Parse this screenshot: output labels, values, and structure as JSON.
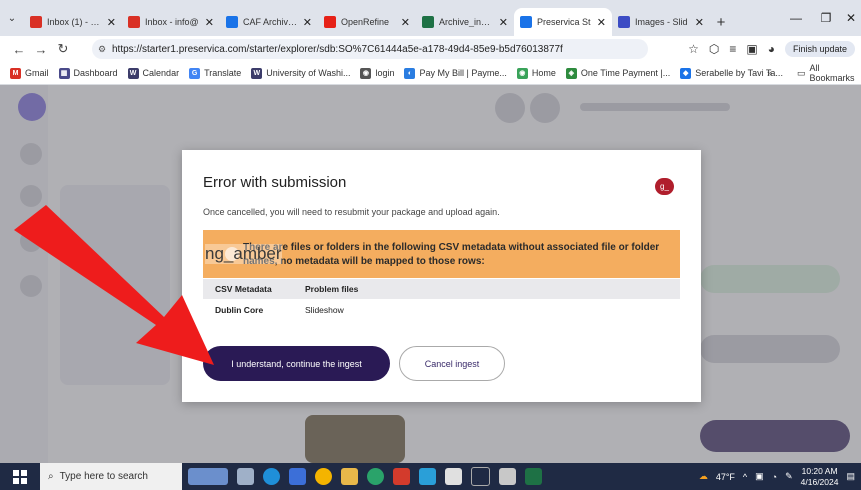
{
  "browser": {
    "tabs": [
      {
        "title": "Inbox (1) - tay",
        "icon": "gmail-icon",
        "color": "#d93025",
        "active": false
      },
      {
        "title": "Inbox - info@",
        "icon": "gmail-icon",
        "color": "#d93025",
        "active": false
      },
      {
        "title": "CAF Archive P",
        "icon": "doc-icon",
        "color": "#1a73e8",
        "active": false
      },
      {
        "title": "OpenRefine",
        "icon": "youtube-icon",
        "color": "#e62117",
        "active": false
      },
      {
        "title": "Archive_inven",
        "icon": "excel-icon",
        "color": "#1e7145",
        "active": false
      },
      {
        "title": "Preservica St",
        "icon": "preservica-icon",
        "color": "#1a73e8",
        "active": true
      },
      {
        "title": "Images - Slid",
        "icon": "slides-icon",
        "color": "#3c4cc4",
        "active": false
      }
    ],
    "url": "https://starter1.preservica.com/starter/explorer/sdb:SO%7C61444a5e-a178-49d4-85e9-b5d76013877f",
    "finish_update": "Finish update",
    "bookmarks": [
      {
        "label": "Gmail",
        "color": "#d93025",
        "glyph": "M"
      },
      {
        "label": "Dashboard",
        "color": "#4a4a8a",
        "glyph": "▦"
      },
      {
        "label": "Calendar",
        "color": "#3c3c6a",
        "glyph": "W"
      },
      {
        "label": "Translate",
        "color": "#4285f4",
        "glyph": "G"
      },
      {
        "label": "University of Washi...",
        "color": "#3c3c6a",
        "glyph": "W"
      },
      {
        "label": "login",
        "color": "#555555",
        "glyph": "◉"
      },
      {
        "label": "Pay My Bill | Payme...",
        "color": "#2a7de1",
        "glyph": "◐"
      },
      {
        "label": "Home",
        "color": "#3aa35a",
        "glyph": "◉"
      },
      {
        "label": "One Time Payment |...",
        "color": "#2e8b3e",
        "glyph": "◈"
      },
      {
        "label": "Serabelle by Tavi Ta...",
        "color": "#1a73e8",
        "glyph": "◆"
      }
    ],
    "bookmarks_more": "»",
    "all_bookmarks": "All Bookmarks"
  },
  "modal": {
    "title": "Error with submission",
    "subtitle": "Once cancelled, you will need to resubmit your package and upload again.",
    "badge": "g_",
    "warning": "There are files or folders in the following CSV metadata without associated file or folder names, no metadata will be mapped to those rows:",
    "overlay_label": "ng_amber",
    "table": {
      "headers": [
        "CSV Metadata",
        "Problem files"
      ],
      "rows": [
        [
          "Dublin Core",
          "Slideshow"
        ]
      ]
    },
    "primary_button": "I understand, continue the ingest",
    "secondary_button": "Cancel ingest"
  },
  "taskbar": {
    "search_placeholder": "Type here to search",
    "weather": "47°F",
    "time": "10:20 AM",
    "date": "4/16/2024"
  }
}
